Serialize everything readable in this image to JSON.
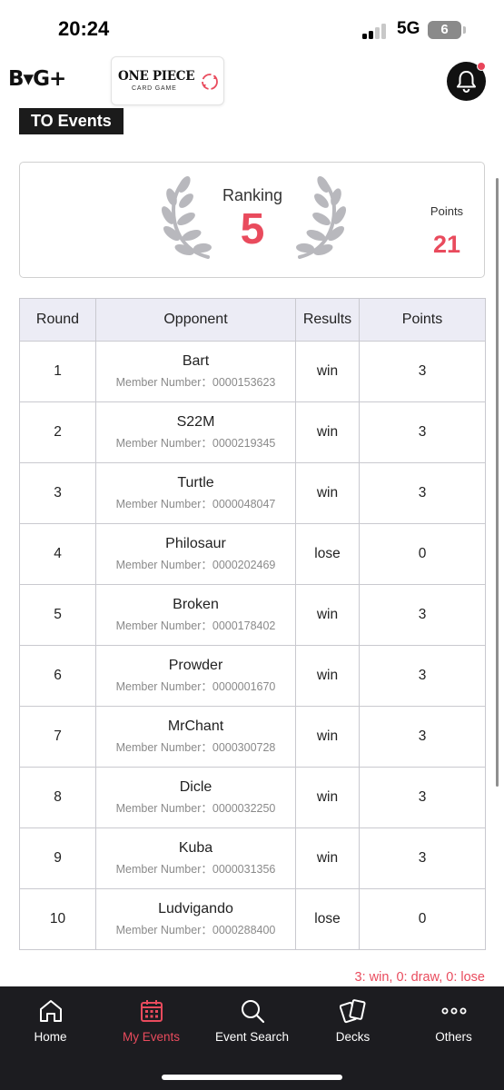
{
  "status_bar": {
    "time": "20:24",
    "network": "5G",
    "battery": "6"
  },
  "header": {
    "app_logo": "B▾G+",
    "game_logo_title": "ONE PIECE",
    "game_logo_subtitle": "CARD GAME"
  },
  "section_title": "TO Events",
  "summary": {
    "ranking_label": "Ranking",
    "ranking_value": "5",
    "points_label": "Points",
    "points_value": "21"
  },
  "table": {
    "headers": {
      "round": "Round",
      "opponent": "Opponent",
      "results": "Results",
      "points": "Points"
    },
    "rows": [
      {
        "round": "1",
        "name": "Bart",
        "member": "Member Number：0000153623",
        "result": "win",
        "points": "3"
      },
      {
        "round": "2",
        "name": "S22M",
        "member": "Member Number：0000219345",
        "result": "win",
        "points": "3"
      },
      {
        "round": "3",
        "name": "Turtle",
        "member": "Member Number：0000048047",
        "result": "win",
        "points": "3"
      },
      {
        "round": "4",
        "name": "Philosaur",
        "member": "Member Number：0000202469",
        "result": "lose",
        "points": "0"
      },
      {
        "round": "5",
        "name": "Broken",
        "member": "Member Number：0000178402",
        "result": "win",
        "points": "3"
      },
      {
        "round": "6",
        "name": "Prowder",
        "member": "Member Number：0000001670",
        "result": "win",
        "points": "3"
      },
      {
        "round": "7",
        "name": "MrChant",
        "member": "Member Number：0000300728",
        "result": "win",
        "points": "3"
      },
      {
        "round": "8",
        "name": "Dicle",
        "member": "Member Number：0000032250",
        "result": "win",
        "points": "3"
      },
      {
        "round": "9",
        "name": "Kuba",
        "member": "Member Number：0000031356",
        "result": "win",
        "points": "3"
      },
      {
        "round": "10",
        "name": "Ludvigando",
        "member": "Member Number：0000288400",
        "result": "lose",
        "points": "0"
      }
    ]
  },
  "legend_note": "3: win, 0: draw, 0: lose",
  "nav": {
    "items": [
      {
        "label": "Home",
        "icon": "home-icon",
        "active": false
      },
      {
        "label": "My Events",
        "icon": "calendar-icon",
        "active": true
      },
      {
        "label": "Event Search",
        "icon": "search-icon",
        "active": false
      },
      {
        "label": "Decks",
        "icon": "cards-icon",
        "active": false
      },
      {
        "label": "Others",
        "icon": "more-icon",
        "active": false
      }
    ]
  },
  "colors": {
    "accent": "#e94b5d",
    "nav_background": "#1c1c20",
    "table_header": "#ececf5",
    "title_background": "#1b1b1b"
  }
}
